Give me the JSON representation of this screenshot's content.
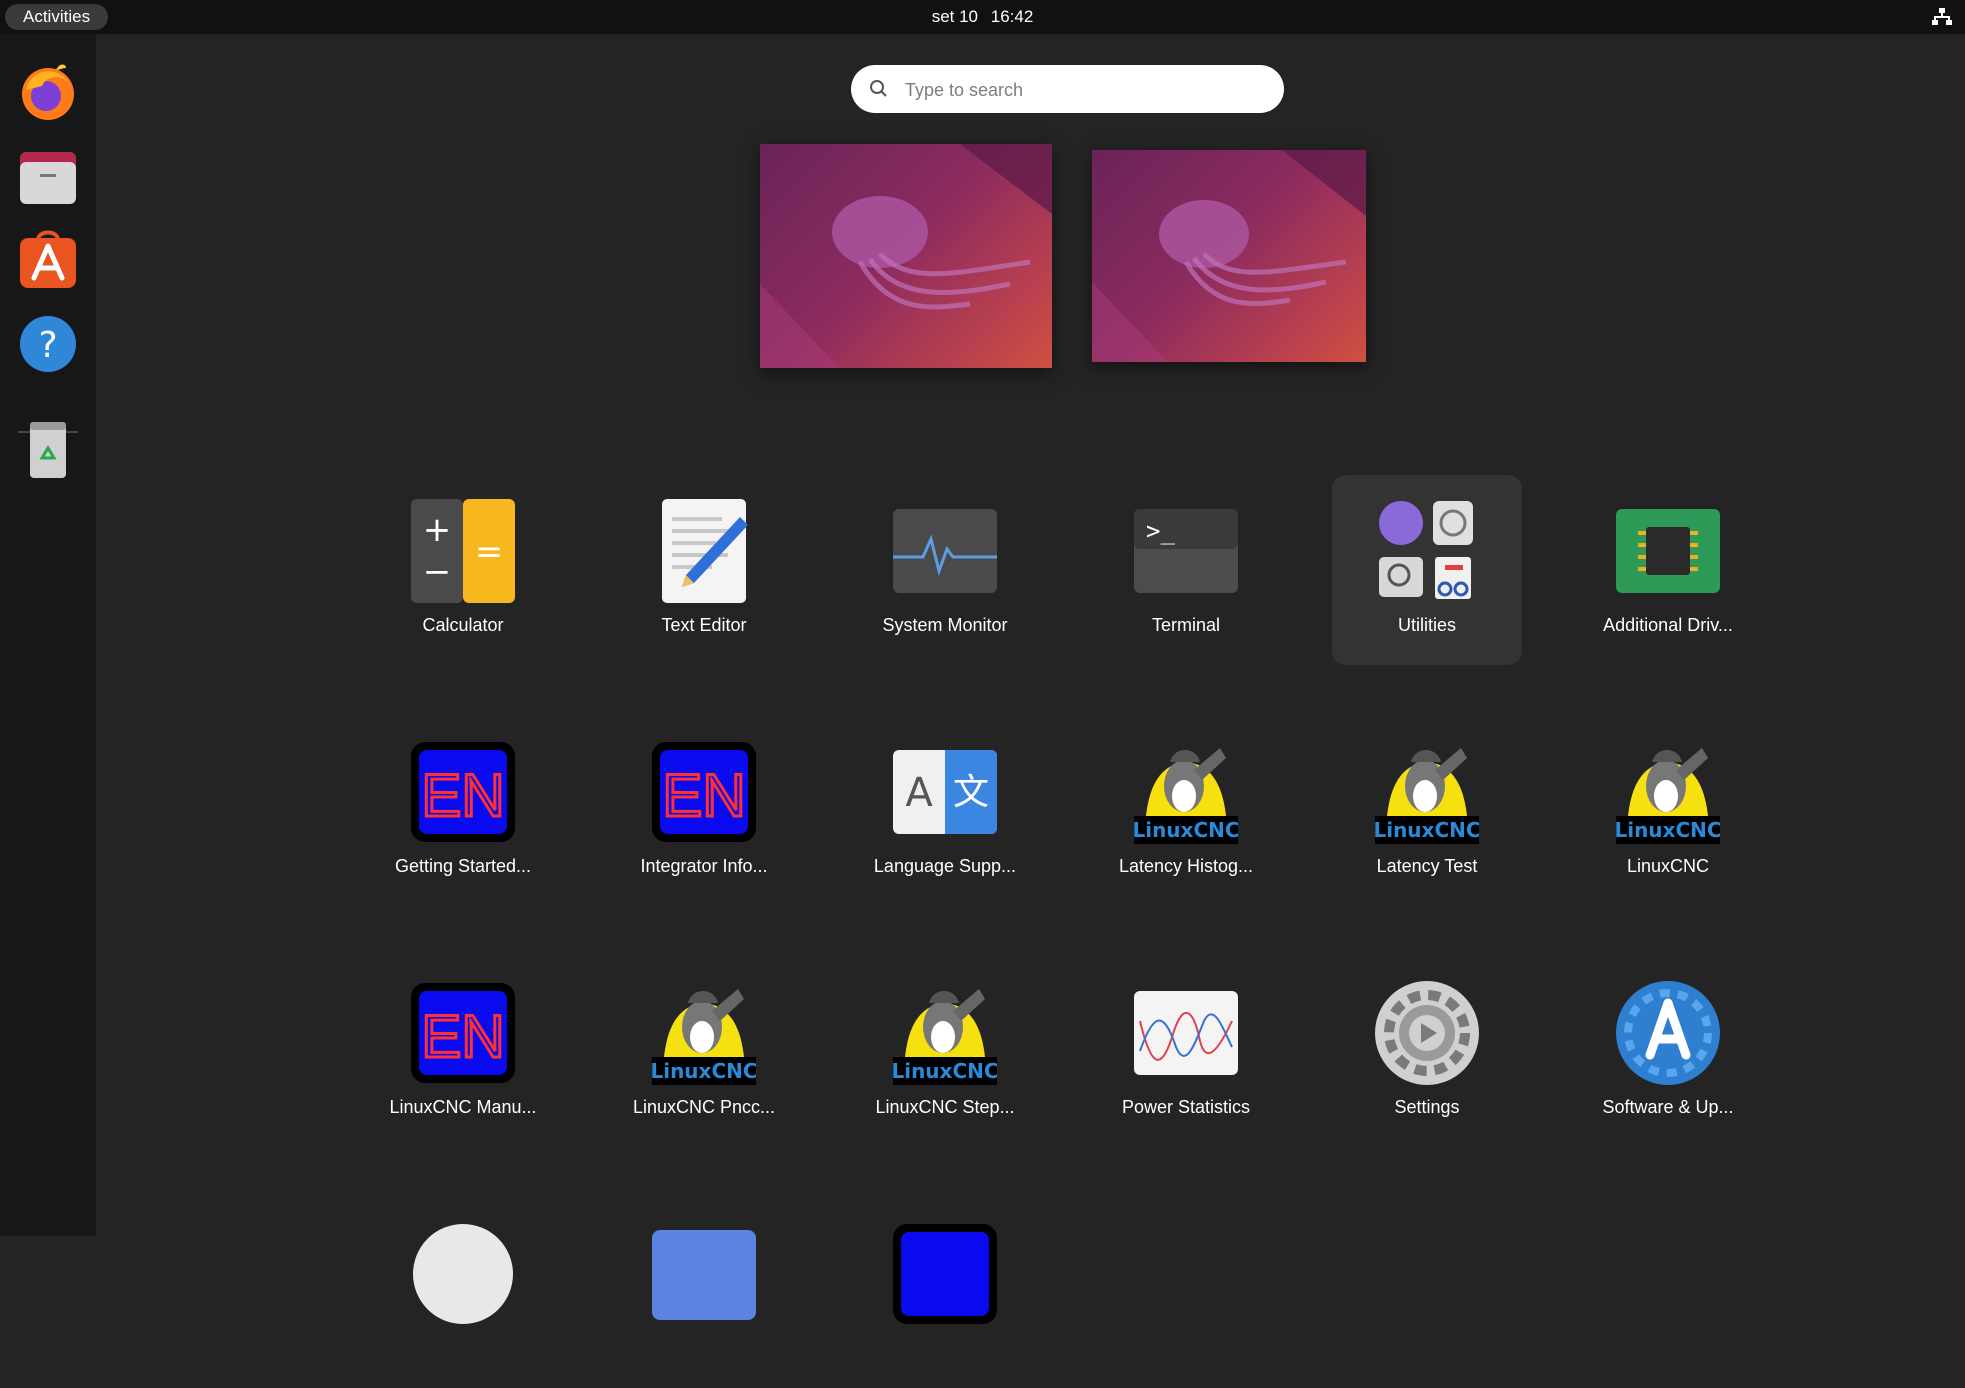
{
  "topbar": {
    "activities_label": "Activities",
    "date": "set 10",
    "time": "16:42"
  },
  "dock": {
    "items": [
      {
        "name": "Firefox",
        "icon": "firefox-icon"
      },
      {
        "name": "Files",
        "icon": "files-icon"
      },
      {
        "name": "Ubuntu Software",
        "icon": "app-store-icon"
      },
      {
        "name": "Help",
        "icon": "help-icon"
      },
      {
        "name": "Trash",
        "icon": "trash-icon"
      }
    ]
  },
  "search": {
    "placeholder": "Type to search"
  },
  "workspaces": [
    {
      "name": "workspace-1",
      "wallpaper": "jellyfish"
    },
    {
      "name": "workspace-2",
      "wallpaper": "jellyfish"
    }
  ],
  "apps": [
    {
      "label": "Calculator",
      "icon": "calculator-icon"
    },
    {
      "label": "Text Editor",
      "icon": "text-editor-icon"
    },
    {
      "label": "System Monitor",
      "icon": "system-monitor-icon"
    },
    {
      "label": "Terminal",
      "icon": "terminal-icon"
    },
    {
      "label": "Utilities",
      "icon": "utilities-folder-icon"
    },
    {
      "label": "Additional Driv...",
      "icon": "chip-icon"
    },
    {
      "label": "Getting Started...",
      "icon": "en-icon"
    },
    {
      "label": "Integrator Info...",
      "icon": "en-icon"
    },
    {
      "label": "Language Supp...",
      "icon": "language-icon"
    },
    {
      "label": "Latency Histog...",
      "icon": "linuxcnc-icon"
    },
    {
      "label": "Latency Test",
      "icon": "linuxcnc-icon"
    },
    {
      "label": "LinuxCNC",
      "icon": "linuxcnc-icon"
    },
    {
      "label": "LinuxCNC Manu...",
      "icon": "en-icon"
    },
    {
      "label": "LinuxCNC Pncc...",
      "icon": "linuxcnc-icon"
    },
    {
      "label": "LinuxCNC Step...",
      "icon": "linuxcnc-icon"
    },
    {
      "label": "Power Statistics",
      "icon": "power-statistics-icon"
    },
    {
      "label": "Settings",
      "icon": "settings-icon"
    },
    {
      "label": "Software & Up...",
      "icon": "software-updates-icon"
    }
  ],
  "icon_text": {
    "en": "EN",
    "linuxcnc": "LinuxCNC",
    "language_latin": "A",
    "language_cjk": "文",
    "terminal_prompt": ">_",
    "calc_plus": "+",
    "calc_minus": "−",
    "calc_equals": "=",
    "help": "?"
  },
  "colors": {
    "background": "#242424",
    "topbar": "#111111",
    "dock": "#171717",
    "en_blue": "#0000ee",
    "en_red": "#ff2a2a",
    "linuxcnc_text": "#2a8ad8"
  }
}
